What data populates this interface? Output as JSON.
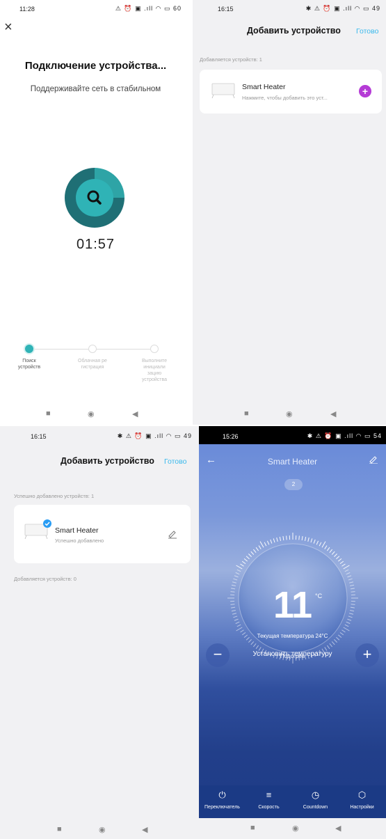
{
  "panel1": {
    "status": {
      "time": "11:28",
      "icons": "⚠ ⏰ ▣ .ıll ◠ ▭ 60"
    },
    "close_icon": "×",
    "title": "Подключение устройства...",
    "subtitle": "Поддерживайте сеть в стабильном",
    "timer": "01:57",
    "steps": [
      {
        "label_l1": "Поиск",
        "label_l2": "устройств",
        "label_l3": "",
        "label_l4": ""
      },
      {
        "label_l1": "Облачная ре",
        "label_l2": "гистрация",
        "label_l3": "",
        "label_l4": ""
      },
      {
        "label_l1": "Выполните",
        "label_l2": "инициали",
        "label_l3": "зацию",
        "label_l4": "устройства"
      }
    ]
  },
  "panel2": {
    "status": {
      "time": "16:15",
      "icons": "✱ ⚠ ⏰ ▣ .ıll ◠ ▭ 49"
    },
    "title": "Добавить устройство",
    "done": "Готово",
    "section": "Добавляется устройств: 1",
    "device": {
      "name": "Smart Heater",
      "sub": "Нажмите, чтобы добавить это уст..."
    },
    "plus": "+"
  },
  "panel3": {
    "status": {
      "time": "16:15",
      "icons": "✱ ⚠ ⏰ ▣ .ıll ◠ ▭ 49"
    },
    "title": "Добавить устройство",
    "done": "Готово",
    "section_success": "Успешно добавлено устройств: 1",
    "device": {
      "name": "Smart Heater",
      "sub": "Успешно добавлено"
    },
    "section_adding": "Добавляется устройств: 0"
  },
  "panel4": {
    "status": {
      "time": "15:26",
      "icons": "✱ ⚠ ⏰ ▣ .ıll ◠ ▭ 54"
    },
    "title": "Smart Heater",
    "pill": "2",
    "temperature": "11",
    "unit": "°C",
    "current_temp": "Текущая температура 24°C",
    "mode": "Подогрев",
    "set_label": "Установить температуру",
    "minus": "−",
    "plus": "+",
    "controls": [
      {
        "icon": "⏻",
        "label": "Переключатель"
      },
      {
        "icon": "≡",
        "label": "Скорость"
      },
      {
        "icon": "◷",
        "label": "Countdown"
      },
      {
        "icon": "⬡",
        "label": "Настройки"
      }
    ]
  },
  "nav": {
    "recent": "■",
    "home": "◉",
    "back": "◀"
  }
}
